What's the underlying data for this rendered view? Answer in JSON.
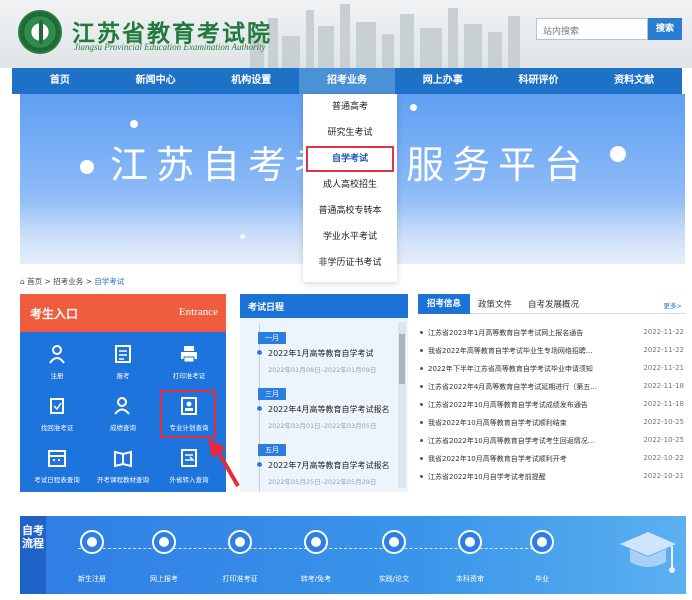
{
  "header": {
    "site_title": "江苏省教育考试院",
    "site_subtitle": "Jiangsu Provincial Education Examination Authority",
    "search_placeholder": "站内搜索",
    "search_button": "搜索"
  },
  "nav": {
    "items": [
      {
        "label": "首页"
      },
      {
        "label": "新闻中心"
      },
      {
        "label": "机构设置"
      },
      {
        "label": "招考业务"
      },
      {
        "label": "网上办事"
      },
      {
        "label": "科研评价"
      },
      {
        "label": "资料文献"
      }
    ],
    "active_index": 3
  },
  "banner": {
    "title": "江苏自考考      息服务平台"
  },
  "dropdown": {
    "items": [
      {
        "label": "普通高考"
      },
      {
        "label": "研究生考试"
      },
      {
        "label": "自学考试"
      },
      {
        "label": "成人高校招生"
      },
      {
        "label": "普通高校专转本"
      },
      {
        "label": "学业水平考试"
      },
      {
        "label": "非学历证书考试"
      }
    ],
    "highlighted_index": 2
  },
  "breadcrumb": {
    "home": "首页",
    "sep": ">",
    "level1": "招考业务",
    "level2": "自学考试"
  },
  "entrance": {
    "title": "考生入口",
    "title_en": "Entrance",
    "items": [
      {
        "label": "注册",
        "icon": "person-icon"
      },
      {
        "label": "报考",
        "icon": "form-icon"
      },
      {
        "label": "打印准考证",
        "icon": "printer-icon"
      },
      {
        "label": "找回准考证",
        "icon": "refresh-icon"
      },
      {
        "label": "成绩查询",
        "icon": "search-person-icon"
      },
      {
        "label": "专业计划查询",
        "icon": "plan-icon"
      },
      {
        "label": "考试日程表查询",
        "icon": "calendar-icon"
      },
      {
        "label": "开考课程教材查询",
        "icon": "book-icon"
      },
      {
        "label": "外省转入查询",
        "icon": "transfer-icon"
      }
    ]
  },
  "schedule": {
    "title": "考试日程",
    "entries": [
      {
        "month": "一月",
        "title": "2022年1月高等教育自学考试",
        "date": "2022年01月08日–2022年01月09日"
      },
      {
        "month": "三月",
        "title": "2022年4月高等教育自学考试报名",
        "date": "2022年03月01日–2022年03月05日"
      },
      {
        "month": "五月",
        "title": "2022年7月高等教育自学考试报名",
        "date": "2022年05月25日–2022年05月29日"
      }
    ]
  },
  "news": {
    "tabs": [
      "招考信息",
      "政策文件",
      "自考发展概况"
    ],
    "more": "更多>",
    "rows": [
      {
        "title": "江苏省2023年1月高等教育自学考试网上报名通告",
        "date": "2022-11-22"
      },
      {
        "title": "我省2022年高等教育自学考试毕业生专场网络招聘...",
        "date": "2022-11-22"
      },
      {
        "title": "2022年下半年江苏省高等教育自学考试毕业申请须知",
        "date": "2022-11-21"
      },
      {
        "title": "江苏省2022年4月高等教育自学考试延期进行（第五...",
        "date": "2022-11-18"
      },
      {
        "title": "江苏省2022年10月高等教育自学考试成绩发布通告",
        "date": "2022-11-18"
      },
      {
        "title": "我省2022年10月高等教育自学考试顺利结束",
        "date": "2022-10-25"
      },
      {
        "title": "江苏省2022年10月高等教育自学考试考生回返情况...",
        "date": "2022-10-25"
      },
      {
        "title": "我省2022年10月高等教育自学考试顺利开考",
        "date": "2022-10-22"
      },
      {
        "title": "江苏省2022年10月自学考试考前提醒",
        "date": "2022-10-21"
      }
    ]
  },
  "process": {
    "label": "自考流程",
    "steps": [
      {
        "label": "新生注册"
      },
      {
        "label": "网上报考"
      },
      {
        "label": "打印准考证"
      },
      {
        "label": "转考/免考"
      },
      {
        "label": "实践/论文"
      },
      {
        "label": "本科资审"
      },
      {
        "label": "毕业"
      }
    ]
  },
  "colors": {
    "nav_blue": "#1d72c8",
    "entrance_blue": "#1d74dd",
    "entrance_header": "#ef5c3e",
    "highlight_red": "#e33342",
    "brand_green": "#1f7a3c"
  }
}
